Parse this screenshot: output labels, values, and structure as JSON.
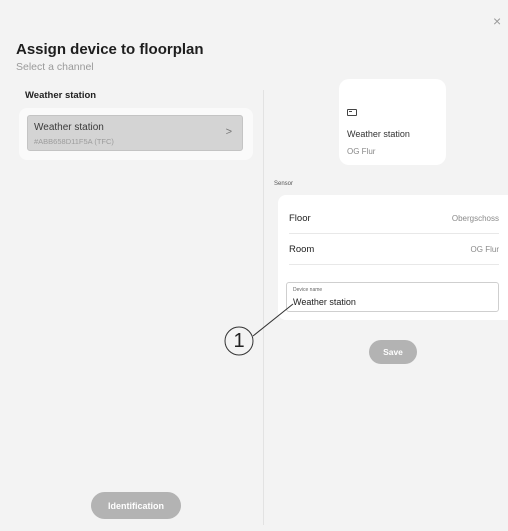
{
  "dialog": {
    "title": "Assign device to floorplan",
    "subtitle": "Select a channel",
    "close_glyph": "×"
  },
  "left_panel": {
    "heading": "Weather station",
    "device": {
      "name": "Weather station",
      "id": "#ABB658D11F5A (TFC)",
      "chevron": ">"
    },
    "identification_button": "Identification"
  },
  "preview": {
    "icon": "device-icon",
    "name": "Weather station",
    "room": "OG Flur"
  },
  "sensor": {
    "section_label": "Sensor",
    "rows": [
      {
        "label": "Floor",
        "value": "Obergschoss"
      },
      {
        "label": "Room",
        "value": "OG Flur"
      }
    ],
    "device_name_label": "Device name",
    "device_name_value": "Weather station",
    "save_button": "Save"
  },
  "callout": {
    "number": "1"
  }
}
